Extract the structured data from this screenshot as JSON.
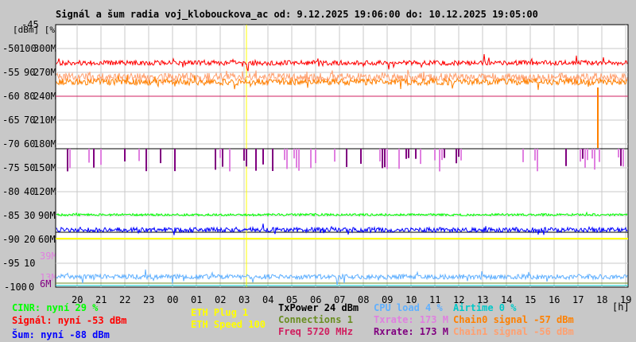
{
  "chart_data": {
    "type": "line",
    "title": "Signál a šum radia voj_klobouckova_ac od: 9.12.2025 19:06:00 do: 10.12.2025 19:05:00",
    "ylabel_units": "[dBm] [%]",
    "y_top_label": "-45",
    "y_ticks": [
      {
        "dbm": "-50",
        "pct": "100",
        "rate": "300M"
      },
      {
        "dbm": "-55",
        "pct": "90",
        "rate": "270M"
      },
      {
        "dbm": "-60",
        "pct": "80",
        "rate": "240M"
      },
      {
        "dbm": "-65",
        "pct": "70",
        "rate": "210M"
      },
      {
        "dbm": "-70",
        "pct": "60",
        "rate": "180M"
      },
      {
        "dbm": "-75",
        "pct": "50",
        "rate": "150M"
      },
      {
        "dbm": "-80",
        "pct": "40",
        "rate": "120M"
      },
      {
        "dbm": "-85",
        "pct": "30",
        "rate": "90M"
      },
      {
        "dbm": "-90",
        "pct": "20",
        "rate": "60M"
      },
      {
        "dbm": "-95",
        "pct": "10",
        "rate": ""
      },
      {
        "dbm": "-100",
        "pct": "0",
        "rate": ""
      }
    ],
    "extra_ticks": [
      {
        "label": "39M",
        "color": "#e080e0"
      },
      {
        "label": "13M",
        "color": "#e080e0"
      },
      {
        "label": "6M",
        "color": "#800080"
      }
    ],
    "ylim": [
      -100,
      -45
    ],
    "x_ticks": [
      "20",
      "21",
      "22",
      "23",
      "00",
      "01",
      "02",
      "03",
      "04",
      "05",
      "06",
      "07",
      "08",
      "09",
      "10",
      "11",
      "12",
      "13",
      "14",
      "15",
      "16",
      "17",
      "18",
      "19"
    ],
    "x_unit": "[h]",
    "series": [
      {
        "name": "Signál",
        "color": "#ff0000",
        "level": -53
      },
      {
        "name": "Chain0 signal",
        "color": "#ff8000",
        "level": -57
      },
      {
        "name": "Chain1 signal",
        "color": "#ffa070",
        "level": -56
      },
      {
        "name": "Freq",
        "color": "#d02060",
        "level": -60
      },
      {
        "name": "Rxrate",
        "color": "#800080",
        "level": 173
      },
      {
        "name": "Txrate",
        "color": "#e080e0",
        "level": 173
      },
      {
        "name": "TxPower",
        "color": "#000000",
        "level": -71
      },
      {
        "name": "CINR",
        "color": "#00ff00",
        "level": 29
      },
      {
        "name": "Šum",
        "color": "#0000ff",
        "level": -88
      },
      {
        "name": "ETH Speed",
        "color": "#ffff00",
        "level": 100
      },
      {
        "name": "CPU load",
        "color": "#60b0ff",
        "level": 4
      },
      {
        "name": "Connections",
        "color": "#6b8e23",
        "level": 1
      },
      {
        "name": "Airtime",
        "color": "#00c8c8",
        "level": 0
      }
    ]
  },
  "legend": {
    "cinr": "CINR: nyní 29 %",
    "signal": "Signál: nyní -53 dBm",
    "noise": "Šum: nyní -88 dBm",
    "eth_plug": "ETH Plug 1",
    "eth_speed": "ETH Speed 100",
    "txpower": "TxPower 24 dBm",
    "connections": "Connections 1",
    "freq": "Freq 5720 MHz",
    "cpu": "CPU load 4 %",
    "txrate": "Txrate: 173 M",
    "rxrate": "Rxrate: 173 M",
    "airtime": "Airtime 0 %",
    "chain0": "Chain0 signal -57 dBm",
    "chain1": "Chain1 signal -56 dBm"
  }
}
